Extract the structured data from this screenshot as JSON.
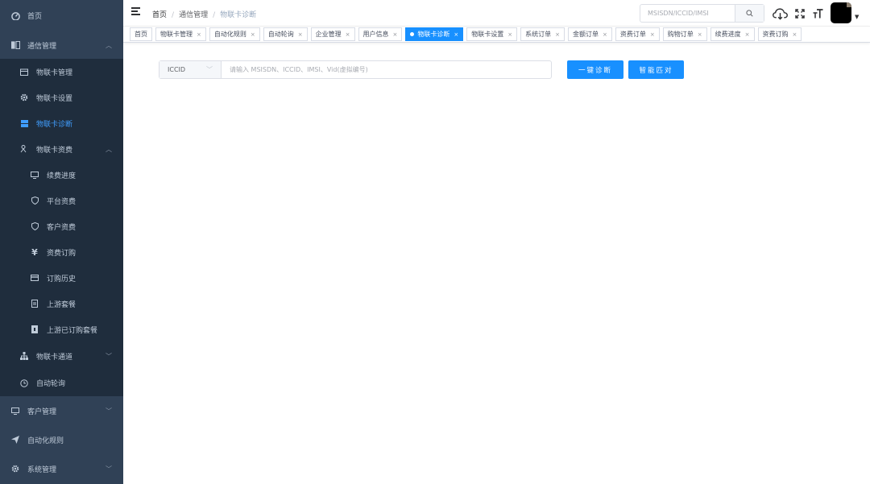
{
  "sidebar": {
    "items": [
      {
        "label": "首页",
        "icon": "dashboard-icon",
        "level": 1
      },
      {
        "label": "通信管理",
        "icon": "book-icon",
        "level": 1,
        "expanded": true
      },
      {
        "label": "物联卡管理",
        "icon": "calendar-icon",
        "level": 2
      },
      {
        "label": "物联卡设置",
        "icon": "gear-icon",
        "level": 2
      },
      {
        "label": "物联卡诊断",
        "icon": "server-icon",
        "level": 2,
        "active": true
      },
      {
        "label": "物联卡资费",
        "icon": "person-icon",
        "level": 2,
        "expanded": true
      },
      {
        "label": "续费进度",
        "icon": "monitor-icon",
        "level": 3
      },
      {
        "label": "平台资费",
        "icon": "shield-icon",
        "level": 3
      },
      {
        "label": "客户资费",
        "icon": "shield-icon",
        "level": 3
      },
      {
        "label": "资费订购",
        "icon": "yen-icon",
        "level": 3
      },
      {
        "label": "订购历史",
        "icon": "card-icon",
        "level": 3
      },
      {
        "label": "上游套餐",
        "icon": "document-icon",
        "level": 3
      },
      {
        "label": "上游已订购套餐",
        "icon": "badge-icon",
        "level": 3
      },
      {
        "label": "物联卡通道",
        "icon": "tree-icon",
        "level": 2
      },
      {
        "label": "自动轮询",
        "icon": "clock-icon",
        "level": 2
      },
      {
        "label": "客户管理",
        "icon": "monitor-icon",
        "level": 1
      },
      {
        "label": "自动化规则",
        "icon": "send-icon",
        "level": 1
      },
      {
        "label": "系统管理",
        "icon": "gear-icon",
        "level": 1
      }
    ]
  },
  "header": {
    "breadcrumb": [
      "首页",
      "通信管理",
      "物联卡诊断"
    ],
    "search_placeholder": "MSISDN/ICCID/IMSI"
  },
  "tags": [
    {
      "label": "首页",
      "closable": false
    },
    {
      "label": "物联卡管理",
      "closable": true
    },
    {
      "label": "自动化规则",
      "closable": true
    },
    {
      "label": "自动轮询",
      "closable": true
    },
    {
      "label": "企业管理",
      "closable": true
    },
    {
      "label": "用户信息",
      "closable": true
    },
    {
      "label": "物联卡诊断",
      "closable": true,
      "active": true
    },
    {
      "label": "物联卡设置",
      "closable": true
    },
    {
      "label": "系统订单",
      "closable": true
    },
    {
      "label": "金额订单",
      "closable": true
    },
    {
      "label": "资费订单",
      "closable": true
    },
    {
      "label": "购物订单",
      "closable": true
    },
    {
      "label": "续费进度",
      "closable": true
    },
    {
      "label": "资费订购",
      "closable": true
    }
  ],
  "main": {
    "select_value": "ICCID",
    "input_placeholder": "请输入 MSISDN、ICCID、IMSI、Vid(虚拟编号)",
    "diagnose_button": "一键诊断",
    "match_button": "智能匹对"
  },
  "colors": {
    "sidebar_bg": "#304156",
    "submenu_bg": "#1f2d3d",
    "primary": "#1890ff",
    "active_text": "#409eff"
  }
}
